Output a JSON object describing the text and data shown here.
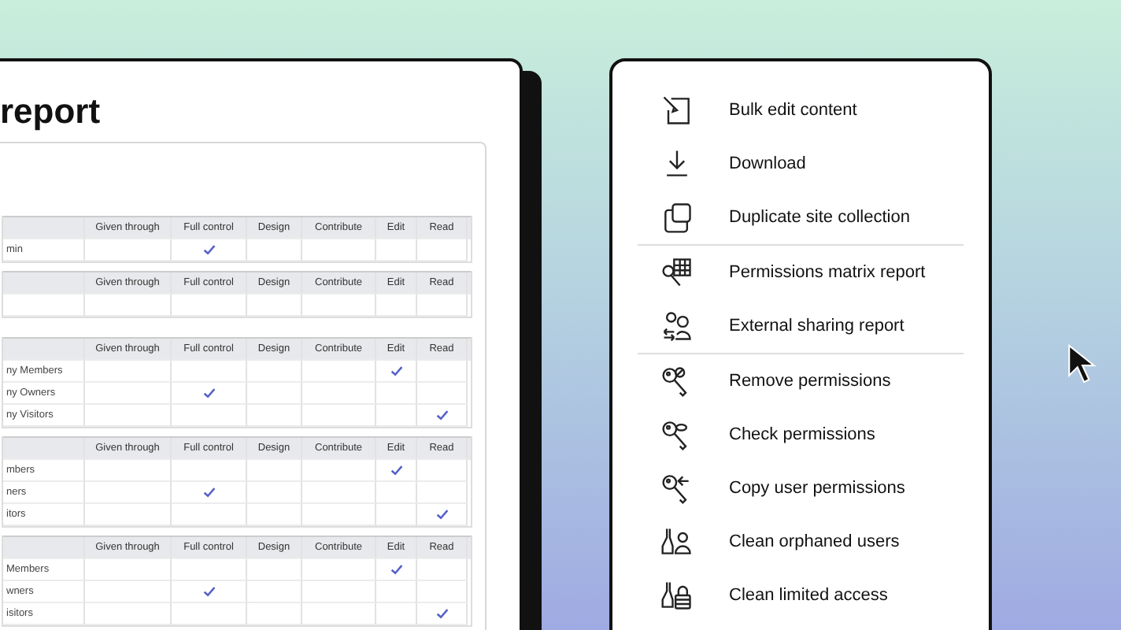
{
  "report": {
    "title": "report",
    "tables": [
      {
        "columns": [
          "Given through",
          "Full control",
          "Design",
          "Contribute",
          "Edit",
          "Read"
        ],
        "rows": [
          {
            "name": "min",
            "checks": [
              true,
              false,
              false,
              false,
              false
            ]
          }
        ]
      },
      {
        "columns": [
          "Given through",
          "Full control",
          "Design",
          "Contribute",
          "Edit",
          "Read"
        ],
        "rows": [
          {
            "checks": [
              false,
              false,
              false,
              false,
              false
            ]
          }
        ]
      },
      {
        "columns": [
          "Given through",
          "Full control",
          "Design",
          "Contribute",
          "Edit",
          "Read"
        ],
        "rows": [
          {
            "name": "ny Members",
            "checks": [
              false,
              false,
              false,
              true,
              false
            ]
          },
          {
            "name": "ny Owners",
            "checks": [
              true,
              false,
              false,
              false,
              false
            ]
          },
          {
            "name": "ny Visitors",
            "checks": [
              false,
              false,
              false,
              false,
              true
            ]
          }
        ]
      },
      {
        "columns": [
          "Given through",
          "Full control",
          "Design",
          "Contribute",
          "Edit",
          "Read"
        ],
        "rows": [
          {
            "name": "mbers",
            "checks": [
              false,
              false,
              false,
              true,
              false
            ]
          },
          {
            "name": "ners",
            "checks": [
              true,
              false,
              false,
              false,
              false
            ]
          },
          {
            "name": "itors",
            "checks": [
              false,
              false,
              false,
              false,
              true
            ]
          }
        ]
      },
      {
        "columns": [
          "Given through",
          "Full control",
          "Design",
          "Contribute",
          "Edit",
          "Read"
        ],
        "rows": [
          {
            "name": "Members",
            "checks": [
              false,
              false,
              false,
              true,
              false
            ]
          },
          {
            "name": "wners",
            "checks": [
              true,
              false,
              false,
              false,
              false
            ]
          },
          {
            "name": "isitors",
            "checks": [
              false,
              false,
              false,
              false,
              true
            ]
          }
        ]
      }
    ]
  },
  "menu": {
    "groups": [
      [
        {
          "kind": "edit",
          "label": "Bulk edit content"
        },
        {
          "kind": "download",
          "label": "Download"
        },
        {
          "kind": "duplicate",
          "label": "Duplicate site collection"
        }
      ],
      [
        {
          "kind": "matrix",
          "label": "Permissions matrix report"
        },
        {
          "kind": "sharing",
          "label": "External sharing report"
        }
      ],
      [
        {
          "kind": "remove",
          "label": "Remove permissions"
        },
        {
          "kind": "check",
          "label": "Check permissions"
        },
        {
          "kind": "copy",
          "label": "Copy user permissions"
        },
        {
          "kind": "orphaned",
          "label": "Clean orphaned users"
        },
        {
          "kind": "limited",
          "label": "Clean limited access"
        }
      ]
    ]
  }
}
